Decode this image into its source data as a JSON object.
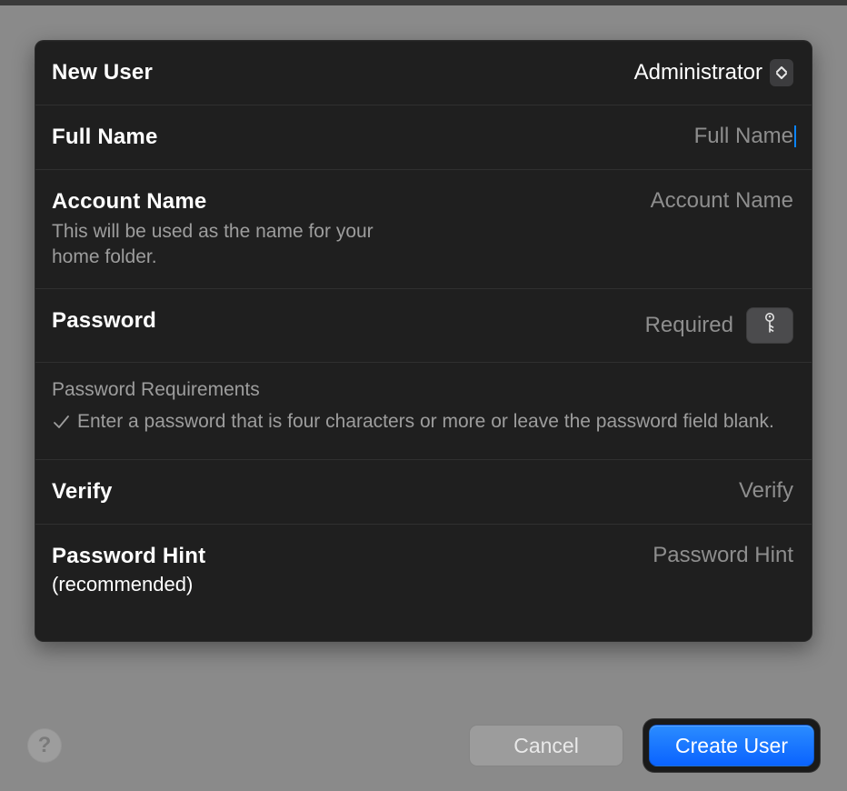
{
  "rows": {
    "type": {
      "label": "New User",
      "selected": "Administrator"
    },
    "fullName": {
      "label": "Full Name",
      "placeholder": "Full Name",
      "value": ""
    },
    "accountName": {
      "label": "Account Name",
      "help": "This will be used as the name for your home folder.",
      "placeholder": "Account Name",
      "value": ""
    },
    "password": {
      "label": "Password",
      "placeholder": "Required",
      "value": ""
    },
    "requirements": {
      "title": "Password Requirements",
      "rule": "Enter a password that is four characters or more or leave the password field blank."
    },
    "verify": {
      "label": "Verify",
      "placeholder": "Verify",
      "value": ""
    },
    "hint": {
      "label": "Password Hint",
      "sub": "(recommended)",
      "placeholder": "Password Hint",
      "value": ""
    }
  },
  "footer": {
    "help": "?",
    "cancel": "Cancel",
    "create": "Create User"
  },
  "colors": {
    "accent": "#0a63ff"
  }
}
